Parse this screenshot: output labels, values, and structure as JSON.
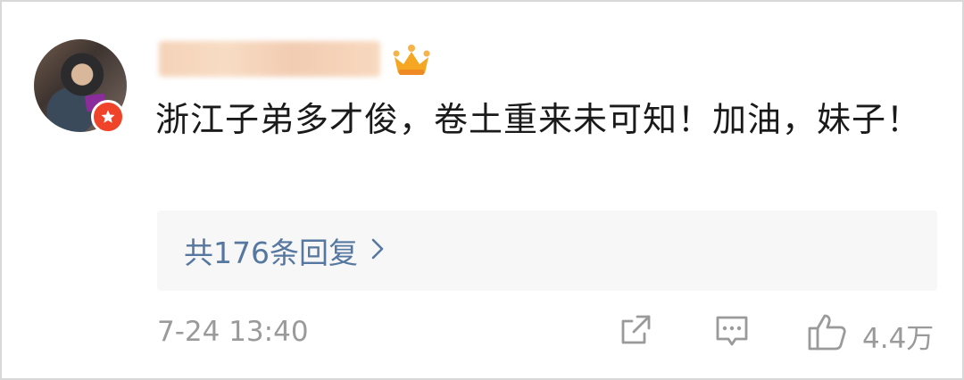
{
  "comment": {
    "text": "浙江子弟多才俊，卷土重来未可知！加油，妹子！",
    "replies_label": "共176条回复",
    "timestamp": "7-24 13:40",
    "like_count": "4.4万"
  },
  "icons": {
    "badge": "star-badge-icon",
    "crown": "crown-icon",
    "share": "share-icon",
    "reply": "comment-icon",
    "like": "thumbs-up-icon"
  },
  "colors": {
    "text": "#1a1a1a",
    "link": "#5677a0",
    "meta": "#9a9a9a",
    "reply_bg": "#f7f7f7",
    "badge": "#f0442a",
    "crown": "#f5a623"
  }
}
